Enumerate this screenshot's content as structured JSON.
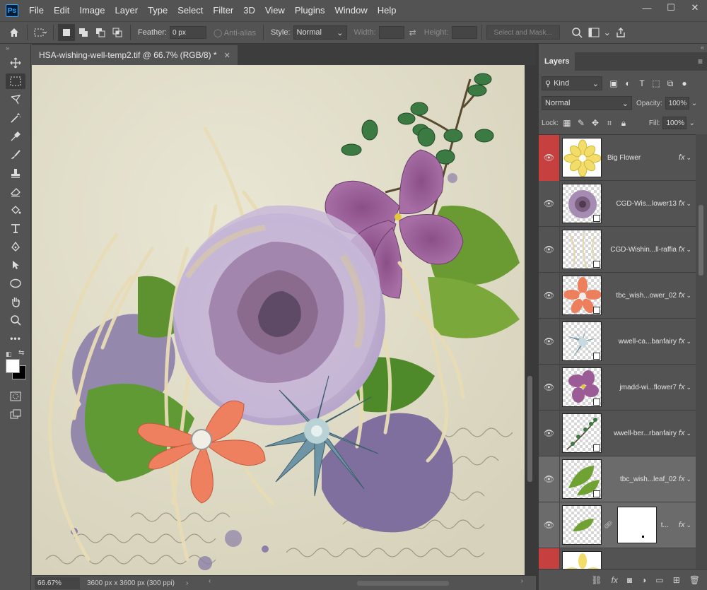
{
  "app": {
    "logo": "Ps"
  },
  "menu": [
    "File",
    "Edit",
    "Image",
    "Layer",
    "Type",
    "Select",
    "Filter",
    "3D",
    "View",
    "Plugins",
    "Window",
    "Help"
  ],
  "options": {
    "feather_label": "Feather:",
    "feather_value": "0 px",
    "antialias_label": "Anti-alias",
    "style_label": "Style:",
    "style_value": "Normal",
    "width_label": "Width:",
    "height_label": "Height:",
    "select_mask_label": "Select and Mask..."
  },
  "document": {
    "tab_title": "HSA-wishing-well-temp2.tif @ 66.7% (RGB/8) *",
    "zoom": "66.67%",
    "doc_size": "3600 px x 3600 px (300 ppi)"
  },
  "layers_panel": {
    "tab": "Layers",
    "kind_filter": "Kind",
    "blend_mode": "Normal",
    "opacity_label": "Opacity:",
    "opacity_value": "100%",
    "lock_label": "Lock:",
    "fill_label": "Fill:",
    "fill_value": "100%",
    "layers": [
      {
        "name": "Big Flower",
        "fx": "fx",
        "thumb": "yellow-flower"
      },
      {
        "name": "CGD-Wis...lower13",
        "fx": "fx",
        "thumb": "paper-flower"
      },
      {
        "name": "CGD-Wishin...ll-raffia",
        "fx": "fx",
        "thumb": "raffia"
      },
      {
        "name": "tbc_wish...ower_02",
        "fx": "fx",
        "thumb": "orange-flower"
      },
      {
        "name": "wwell-ca...banfairy",
        "fx": "fx",
        "thumb": "succulent"
      },
      {
        "name": "jmadd-wi...flower7",
        "fx": "fx",
        "thumb": "purple-flower"
      },
      {
        "name": "wwell-ber...rbanfairy",
        "fx": "fx",
        "thumb": "berries"
      },
      {
        "name": "tbc_wish...leaf_02",
        "fx": "fx",
        "thumb": "leaf"
      },
      {
        "name": "t...",
        "fx": "fx",
        "thumb": "leaf-small"
      }
    ]
  },
  "colors": {
    "accent_red": "#c64040",
    "panel_bg": "#535353",
    "dark_bg": "#282828"
  }
}
